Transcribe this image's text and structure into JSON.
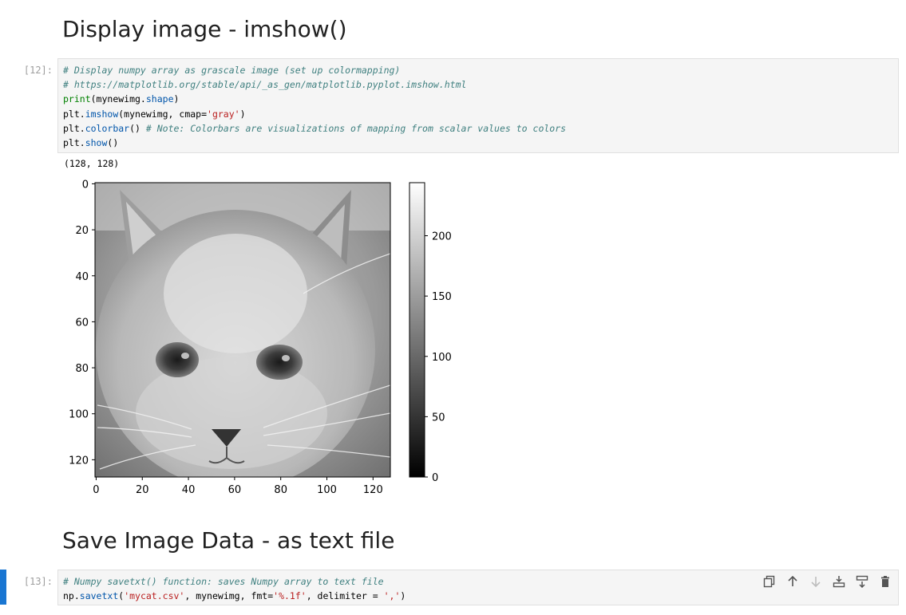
{
  "headings": {
    "display": "Display image - imshow()",
    "save": "Save Image Data - as text file"
  },
  "cell12": {
    "prompt": "[12]:",
    "lines": [
      [
        {
          "t": "cm",
          "v": "# Display numpy array as grascale image (set up colormapping)"
        }
      ],
      [
        {
          "t": "cm",
          "v": "# https://matplotlib.org/stable/api/_as_gen/matplotlib.pyplot.imshow.html"
        }
      ],
      [
        {
          "t": "bi",
          "v": "print"
        },
        {
          "t": "",
          "v": "(mynewimg."
        },
        {
          "t": "at",
          "v": "shape"
        },
        {
          "t": "",
          "v": ")"
        }
      ],
      [
        {
          "t": "",
          "v": "plt."
        },
        {
          "t": "at",
          "v": "imshow"
        },
        {
          "t": "",
          "v": "(mynewimg, cmap="
        },
        {
          "t": "st",
          "v": "'gray'"
        },
        {
          "t": "",
          "v": ")"
        }
      ],
      [
        {
          "t": "",
          "v": "plt."
        },
        {
          "t": "at",
          "v": "colorbar"
        },
        {
          "t": "",
          "v": "() "
        },
        {
          "t": "cm",
          "v": "# Note: Colorbars are visualizations of mapping from scalar values to colors"
        }
      ],
      [
        {
          "t": "",
          "v": "plt."
        },
        {
          "t": "at",
          "v": "show"
        },
        {
          "t": "",
          "v": "()"
        }
      ]
    ],
    "output_text": "(128, 128)"
  },
  "cell13": {
    "prompt": "[13]:",
    "lines": [
      [
        {
          "t": "cm",
          "v": "# Numpy savetxt() function: saves Numpy array to text file"
        }
      ],
      [
        {
          "t": "",
          "v": "np."
        },
        {
          "t": "at",
          "v": "savetxt"
        },
        {
          "t": "",
          "v": "("
        },
        {
          "t": "st",
          "v": "'mycat.csv'"
        },
        {
          "t": "",
          "v": ", mynewimg, fmt="
        },
        {
          "t": "st",
          "v": "'%.1f'"
        },
        {
          "t": "",
          "v": ", delimiter = "
        },
        {
          "t": "st",
          "v": "','"
        },
        {
          "t": "",
          "v": ")"
        }
      ]
    ]
  },
  "toolbar": {
    "icons": [
      "duplicate-icon",
      "move-up-icon",
      "move-down-icon",
      "insert-above-icon",
      "insert-below-icon",
      "delete-icon"
    ]
  },
  "chart_data": {
    "type": "heatmap",
    "image_shape": [
      128,
      128
    ],
    "cmap": "gray",
    "xticks": [
      0,
      20,
      40,
      60,
      80,
      100,
      120
    ],
    "yticks": [
      0,
      20,
      40,
      60,
      80,
      100,
      120
    ],
    "xlim": [
      -0.5,
      127.5
    ],
    "ylim": [
      127.5,
      -0.5
    ],
    "colorbar": {
      "range": [
        0,
        244
      ],
      "ticks": [
        0,
        50,
        100,
        150,
        200
      ]
    }
  }
}
